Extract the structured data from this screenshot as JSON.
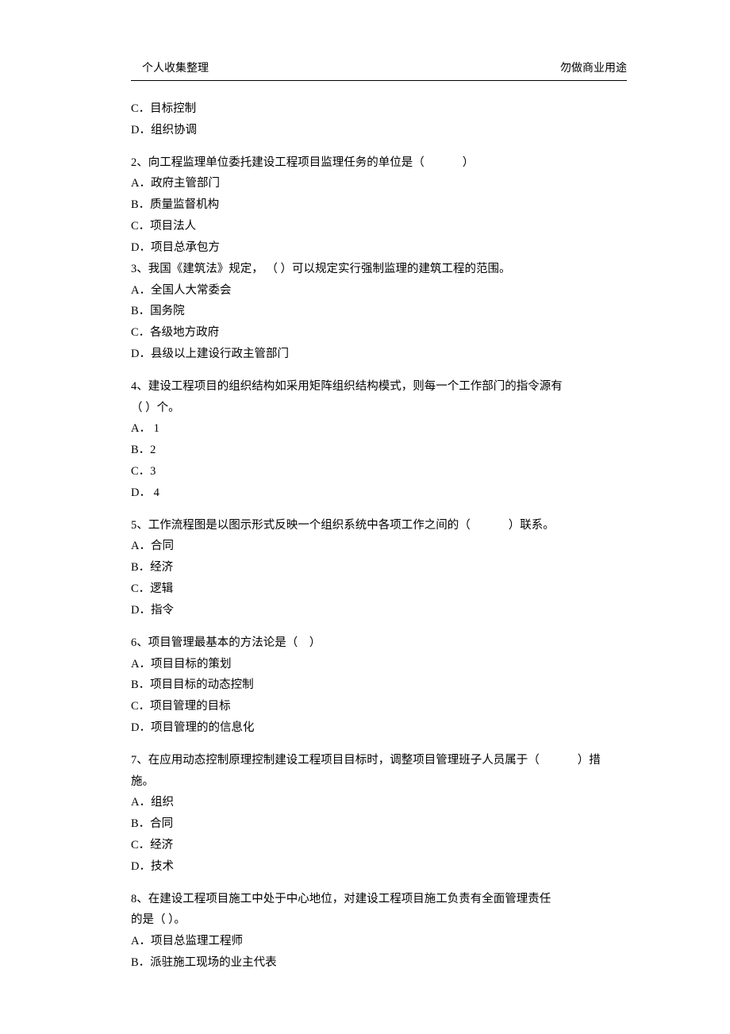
{
  "header": {
    "left": "个人收集整理",
    "right": "勿做商业用途"
  },
  "prelude": {
    "c": "C．目标控制",
    "d": "D．组织协调"
  },
  "q2": {
    "stem_a": "2、向工程监理单位委托建设工程项目监理任务的单位是（",
    "stem_b": "）",
    "a": "A．政府主管部门",
    "b": "B．质量监督机构",
    "c": "C．项目法人",
    "d": "D．项目总承包方"
  },
  "q3": {
    "stem": "3、我国《建筑法》规定， （ ）可以规定实行强制监理的建筑工程的范围。",
    "a": "A．全国人大常委会",
    "b": "B．国务院",
    "c": "C．各级地方政府",
    "d": "D．县级以上建设行政主管部门"
  },
  "q4": {
    "stem1": "4、建设工程项目的组织结构如采用矩阵组织结构模式，则每一个工作部门的指令源有",
    "stem2": "（ ）个。",
    "a": "A． 1",
    "b": "B．2",
    "c": "C．3",
    "d": "D． 4"
  },
  "q5": {
    "stem_a": "5、工作流程图是以图示形式反映一个组织系统中各项工作之间的（",
    "stem_b": "）联系。",
    "a": "A．合同",
    "b": "B．经济",
    "c": "C．逻辑",
    "d": "D．指令"
  },
  "q6": {
    "stem": "6、项目管理最基本的方法论是（　）",
    "a": "A．项目目标的策划",
    "b": "B．项目目标的动态控制",
    "c": "C．项目管理的目标",
    "d": "D．项目管理的的信息化"
  },
  "q7": {
    "stem_a": "7、在应用动态控制原理控制建设工程项目目标时，调整项目管理班子人员属于（",
    "stem_b": "）措",
    "stem2": "施。",
    "a": "A．组织",
    "b": "B．合同",
    "c": "C．经济",
    "d": "D．技术"
  },
  "q8": {
    "stem1": "8、在建设工程项目施工中处于中心地位，对建设工程项目施工负责有全面管理责任",
    "stem2": "的是（ ）。",
    "a": "A．项目总监理工程师",
    "b": "B．派驻施工现场的业主代表"
  }
}
